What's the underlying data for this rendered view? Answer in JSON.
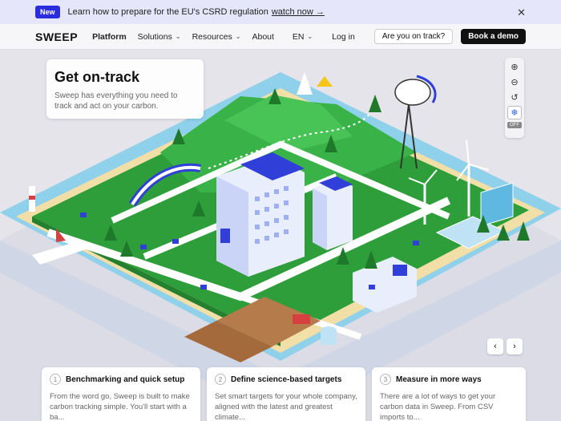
{
  "announcement": {
    "badge": "New",
    "text": "Learn how to prepare for the EU's CSRD regulation",
    "link": "watch now →"
  },
  "nav": {
    "logo": "SWEEP",
    "items": [
      {
        "label": "Platform"
      },
      {
        "label": "Solutions"
      },
      {
        "label": "Resources"
      },
      {
        "label": "About"
      }
    ],
    "lang": "EN",
    "login": "Log in",
    "on_track": "Are you on track?",
    "demo": "Book a demo"
  },
  "hero": {
    "title": "Get on-track",
    "subtitle": "Sweep has everything you need to track and act on your carbon."
  },
  "map_controls": {
    "off_label": "OFF",
    "icons": [
      "zoom-in-icon",
      "zoom-out-icon",
      "reset-icon",
      "snowflake-icon"
    ]
  },
  "cards": [
    {
      "num": "1",
      "title": "Benchmarking and quick setup",
      "body": "From the word go, Sweep is built to make carbon tracking simple. You'll start with a ba..."
    },
    {
      "num": "2",
      "title": "Define science-based targets",
      "body": "Set smart targets for your whole company, aligned with the latest and greatest climate..."
    },
    {
      "num": "3",
      "title": "Measure in more ways",
      "body": "There are a lot of ways to get your carbon data in Sweep. From CSV imports to..."
    }
  ],
  "colors": {
    "accent": "#2b2be0",
    "grass": "#2e9e3a",
    "water": "#5fb8e0",
    "road": "#ffffff",
    "building_blue": "#2f3fd8"
  }
}
